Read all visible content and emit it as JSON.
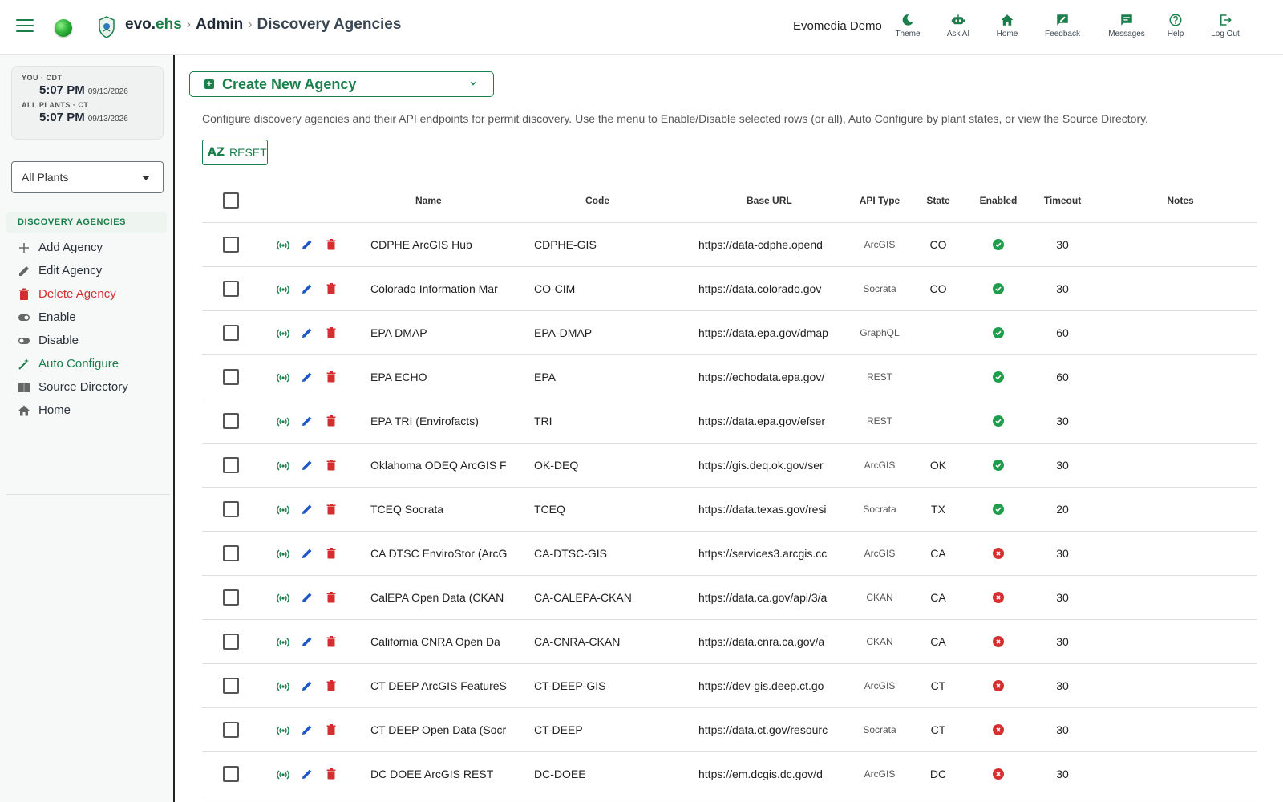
{
  "header": {
    "brand_prefix": "evo.",
    "brand_suffix": "ehs",
    "crumb_sep": "›",
    "crumb_admin": "Admin",
    "crumb_page": "Discovery Agencies",
    "org_name": "Evomedia Demo",
    "buttons": [
      {
        "label": "Theme",
        "icon": "moon-icon"
      },
      {
        "label": "Ask AI",
        "icon": "robot-icon"
      },
      {
        "label": "Home",
        "icon": "home-icon"
      },
      {
        "label": "Feedback",
        "icon": "feedback-icon"
      },
      {
        "label": "Messages",
        "icon": "message-icon"
      },
      {
        "label": "Help",
        "icon": "help-icon"
      },
      {
        "label": "Log Out",
        "icon": "logout-icon"
      }
    ]
  },
  "sidebar": {
    "clock": {
      "you_label": "YOU · CDT",
      "you_time": "5:07 PM",
      "you_date": "09/13/2026",
      "plants_label": "ALL PLANTS · CT",
      "plants_time": "5:07 PM",
      "plants_date": "09/13/2026"
    },
    "plant_select": "All Plants",
    "section_header": "DISCOVERY AGENCIES",
    "menu": [
      {
        "label": "Add Agency",
        "icon": "plus-icon"
      },
      {
        "label": "Edit Agency",
        "icon": "pencil-icon"
      },
      {
        "label": "Delete Agency",
        "icon": "trash-icon"
      },
      {
        "label": "Enable",
        "icon": "toggle-on-icon"
      },
      {
        "label": "Disable",
        "icon": "toggle-off-icon"
      },
      {
        "label": "Auto Configure",
        "icon": "magic-wand-icon"
      },
      {
        "label": "Source Directory",
        "icon": "book-icon"
      },
      {
        "label": "Home",
        "icon": "home-icon"
      }
    ]
  },
  "main": {
    "create_label": "Create New Agency",
    "description": "Configure discovery agencies and their API endpoints for permit discovery. Use the menu to Enable/Disable selected rows (or all), Auto Configure by plant states, or view the Source Directory.",
    "reset_label": "RESET",
    "reset_glyph": "AZ"
  },
  "table": {
    "columns": {
      "name": "Name",
      "code": "Code",
      "url": "Base URL",
      "api": "API Type",
      "state": "State",
      "enabled": "Enabled",
      "timeout": "Timeout",
      "notes": "Notes"
    },
    "rows": [
      {
        "name": "CDPHE ArcGIS Hub",
        "code": "CDPHE-GIS",
        "url": "https://data-cdphe.opend",
        "api": "ArcGIS",
        "state": "CO",
        "enabled": true,
        "timeout": "30"
      },
      {
        "name": "Colorado Information Mar",
        "code": "CO-CIM",
        "url": "https://data.colorado.gov",
        "api": "Socrata",
        "state": "CO",
        "enabled": true,
        "timeout": "30"
      },
      {
        "name": "EPA DMAP",
        "code": "EPA-DMAP",
        "url": "https://data.epa.gov/dmap",
        "api": "GraphQL",
        "state": "",
        "enabled": true,
        "timeout": "60"
      },
      {
        "name": "EPA ECHO",
        "code": "EPA",
        "url": "https://echodata.epa.gov/",
        "api": "REST",
        "state": "",
        "enabled": true,
        "timeout": "60"
      },
      {
        "name": "EPA TRI (Envirofacts)",
        "code": "TRI",
        "url": "https://data.epa.gov/efser",
        "api": "REST",
        "state": "",
        "enabled": true,
        "timeout": "30"
      },
      {
        "name": "Oklahoma ODEQ ArcGIS F",
        "code": "OK-DEQ",
        "url": "https://gis.deq.ok.gov/ser",
        "api": "ArcGIS",
        "state": "OK",
        "enabled": true,
        "timeout": "30"
      },
      {
        "name": "TCEQ Socrata",
        "code": "TCEQ",
        "url": "https://data.texas.gov/resi",
        "api": "Socrata",
        "state": "TX",
        "enabled": true,
        "timeout": "20"
      },
      {
        "name": "CA DTSC EnviroStor (ArcG",
        "code": "CA-DTSC-GIS",
        "url": "https://services3.arcgis.cc",
        "api": "ArcGIS",
        "state": "CA",
        "enabled": false,
        "timeout": "30"
      },
      {
        "name": "CalEPA Open Data (CKAN",
        "code": "CA-CALEPA-CKAN",
        "url": "https://data.ca.gov/api/3/a",
        "api": "CKAN",
        "state": "CA",
        "enabled": false,
        "timeout": "30"
      },
      {
        "name": "California CNRA Open Da",
        "code": "CA-CNRA-CKAN",
        "url": "https://data.cnra.ca.gov/a",
        "api": "CKAN",
        "state": "CA",
        "enabled": false,
        "timeout": "30"
      },
      {
        "name": "CT DEEP ArcGIS FeatureS",
        "code": "CT-DEEP-GIS",
        "url": "https://dev-gis.deep.ct.go",
        "api": "ArcGIS",
        "state": "CT",
        "enabled": false,
        "timeout": "30"
      },
      {
        "name": "CT DEEP Open Data (Socr",
        "code": "CT-DEEP",
        "url": "https://data.ct.gov/resourc",
        "api": "Socrata",
        "state": "CT",
        "enabled": false,
        "timeout": "30"
      },
      {
        "name": "DC DOEE ArcGIS REST",
        "code": "DC-DOEE",
        "url": "https://em.dcgis.dc.gov/d",
        "api": "ArcGIS",
        "state": "DC",
        "enabled": false,
        "timeout": "30"
      }
    ]
  },
  "colors": {
    "accent": "#1a7f4b",
    "danger": "#d32f2f",
    "edit": "#1e56c8",
    "enabled": "#1f9d4c",
    "disabled": "#d62f2f"
  }
}
